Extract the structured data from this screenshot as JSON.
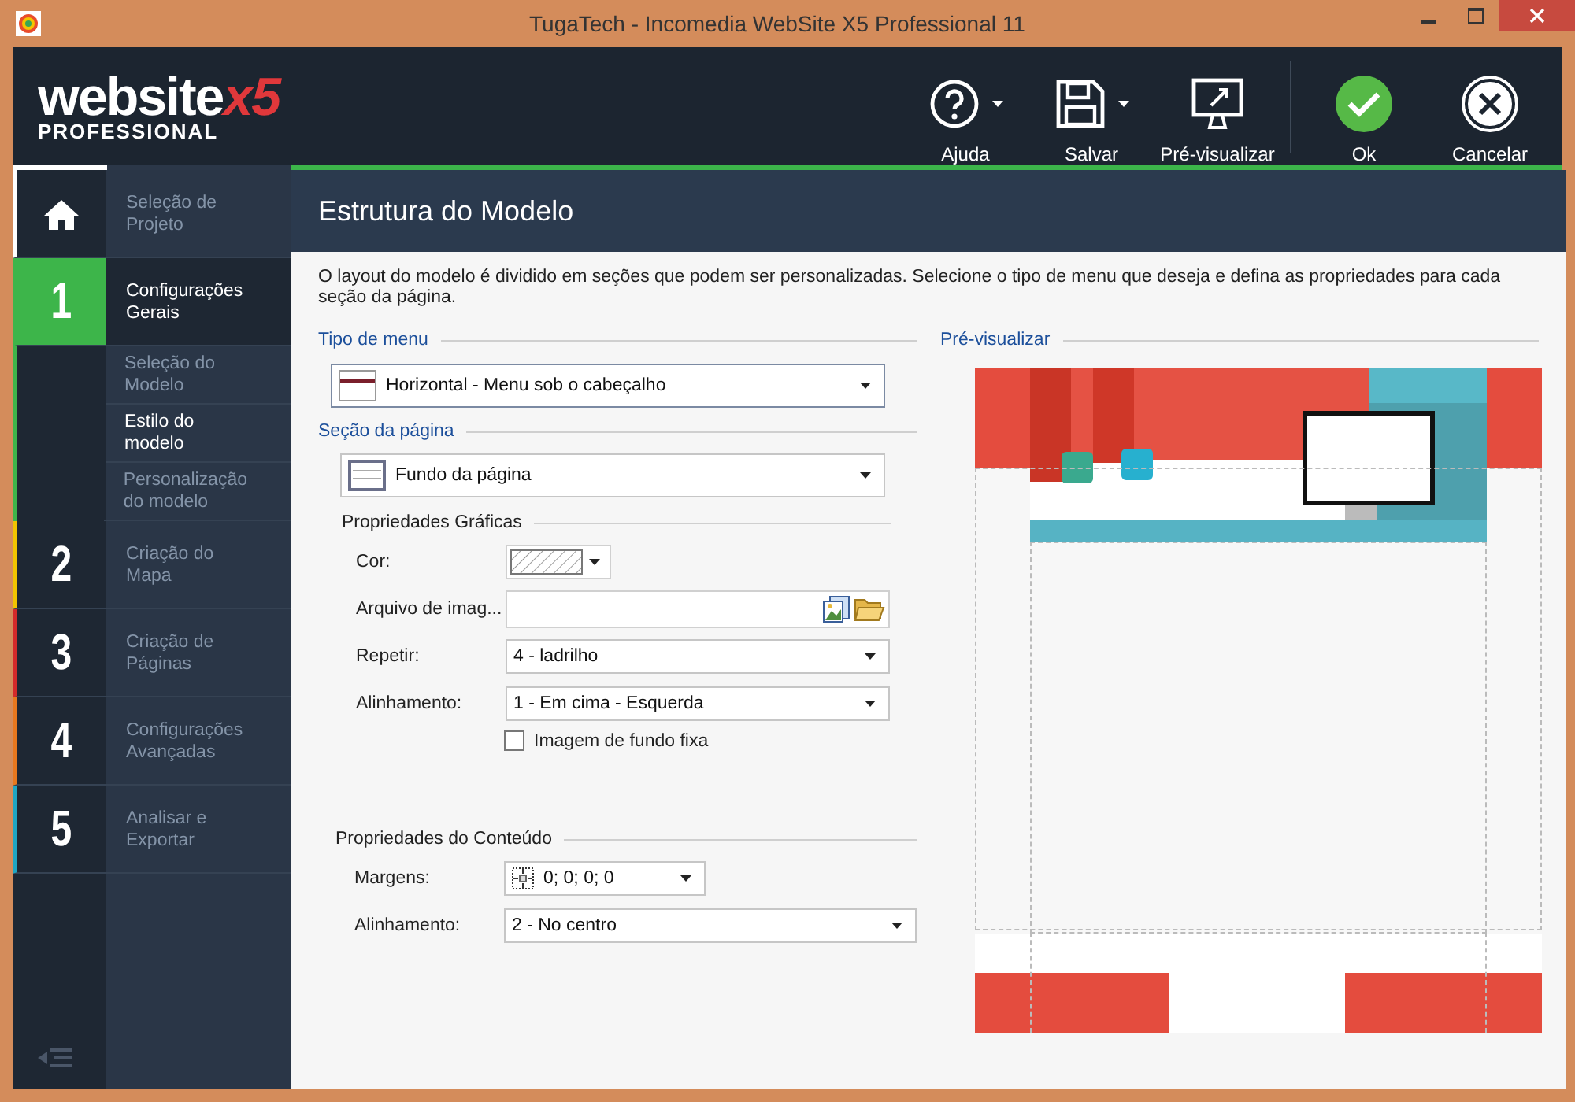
{
  "window": {
    "title": "TugaTech - Incomedia WebSite X5 Professional 11"
  },
  "logo": {
    "word": "website",
    "accent": "x5",
    "edition": "PROFESSIONAL"
  },
  "toolbar": [
    {
      "kind": "help",
      "label": "Ajuda",
      "has_menu": true
    },
    {
      "kind": "save",
      "label": "Salvar",
      "has_menu": true
    },
    {
      "kind": "preview",
      "label": "Pré-visualizar",
      "has_menu": false
    },
    {
      "kind": "ok",
      "label": "Ok",
      "has_menu": false
    },
    {
      "kind": "cancel",
      "label": "Cancelar",
      "has_menu": false
    }
  ],
  "sidebar": {
    "items": [
      {
        "kind": "home",
        "label": "Seleção de Projeto",
        "color": "#ffffff",
        "selected": false
      },
      {
        "kind": "step",
        "number": "1",
        "label": "Configurações Gerais",
        "color": "#3db54a",
        "selected": true,
        "children": [
          {
            "label": "Seleção do Modelo",
            "selected": false
          },
          {
            "label": "Estilo do modelo",
            "selected": true
          },
          {
            "label": "Personalização do modelo",
            "selected": false
          }
        ]
      },
      {
        "kind": "step",
        "number": "2",
        "label": "Criação do Mapa",
        "color": "#f2c500",
        "selected": false
      },
      {
        "kind": "step",
        "number": "3",
        "label": "Criação de Páginas",
        "color": "#d42a2a",
        "selected": false
      },
      {
        "kind": "step",
        "number": "4",
        "label": "Configurações Avançadas",
        "color": "#e8781e",
        "selected": false
      },
      {
        "kind": "step",
        "number": "5",
        "label": "Analisar e Exportar",
        "color": "#1fa6c3",
        "selected": false
      }
    ]
  },
  "page": {
    "title": "Estrutura do Modelo",
    "description": "O layout do modelo é dividido em seções que podem ser personalizadas. Selecione o tipo de menu que deseja e defina as propriedades para cada seção da página.",
    "menu_type": {
      "label": "Tipo de menu",
      "value": "Horizontal - Menu sob o cabeçalho"
    },
    "page_section": {
      "label": "Seção da página",
      "value": "Fundo da página"
    },
    "graphic_properties": {
      "title": "Propriedades Gráficas",
      "color_label": "Cor:",
      "image_label": "Arquivo de imag...",
      "repeat": {
        "label": "Repetir:",
        "value": "4 - ladrilho"
      },
      "alignment": {
        "label": "Alinhamento:",
        "value": "1 - Em cima - Esquerda"
      },
      "fixed_background": {
        "label": "Imagem de fundo fixa",
        "checked": false
      }
    },
    "content_properties": {
      "title": "Propriedades do Conteúdo",
      "margins": {
        "label": "Margens:",
        "value": "0; 0; 0; 0"
      },
      "alignment": {
        "label": "Alinhamento:",
        "value": "2 - No centro"
      }
    },
    "preview": {
      "label": "Pré-visualizar"
    }
  }
}
